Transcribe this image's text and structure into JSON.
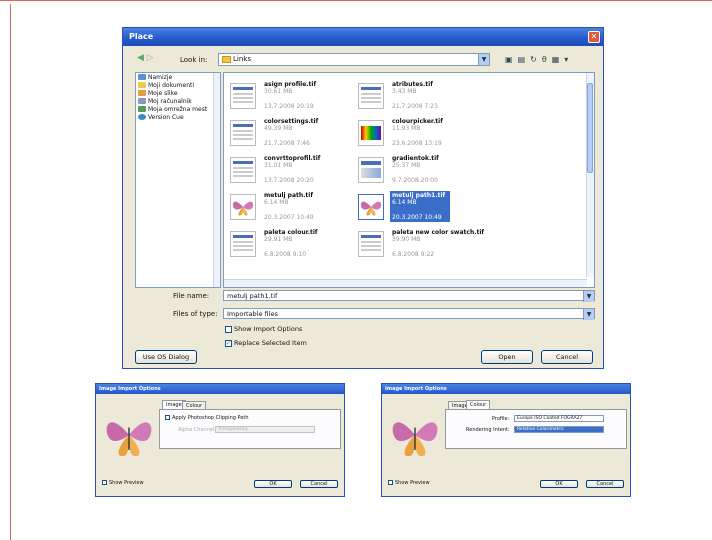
{
  "main_dialog": {
    "title": "Place",
    "look_in_label": "Look in:",
    "look_in_value": "Links",
    "places": [
      "Namizje",
      "Moji dokumenti",
      "Moje slike",
      "Moj računalnik",
      "Moja omrežna mest",
      "Version Cue"
    ],
    "files": [
      {
        "name": "asign profile.tif",
        "size": "30.61 MB",
        "date": "13.7.2008 20:19",
        "thumb": "window"
      },
      {
        "name": "atributes.tif",
        "size": "3.43 MB",
        "date": "21.7.2008 7:23",
        "thumb": "window"
      },
      {
        "name": "colorsettings.tif",
        "size": "49.39 MB",
        "date": "21.7.2008 7:46",
        "thumb": "window"
      },
      {
        "name": "colourpicker.tif",
        "size": "11.93 MB",
        "date": "23.6.2008 13:19",
        "thumb": "gradient"
      },
      {
        "name": "convrttoprofil.tif",
        "size": "31.01 MB",
        "date": "13.7.2008 20:20",
        "thumb": "window"
      },
      {
        "name": "gradientok.tif",
        "size": "25.37 MB",
        "date": "9.7.2008 20:00",
        "thumb": "gradient-window"
      },
      {
        "name": "metulj path.tif",
        "size": "6.14 MB",
        "date": "20.3.2007 10:49",
        "thumb": "butterfly"
      },
      {
        "name": "metulj path1.tif",
        "size": "6.14 MB",
        "date": "20.3.2007 10:49",
        "thumb": "butterfly",
        "selected": true
      },
      {
        "name": "paleta colour.tif",
        "size": "29.91 MB",
        "date": "6.8.2008 9:10",
        "thumb": "window"
      },
      {
        "name": "paleta new color swatch.tif",
        "size": "39.90 MB",
        "date": "6.8.2008 9:22",
        "thumb": "window"
      }
    ],
    "file_name_label": "File name:",
    "file_name_value": "metulj path1.tif",
    "files_of_type_label": "Files of type:",
    "files_of_type_value": "Importable files",
    "show_import_options": "Show Import Options",
    "replace_selected_item": "Replace Selected Item",
    "use_os_dialog": "Use OS Dialog",
    "open": "Open",
    "cancel": "Cancel"
  },
  "image_import_left": {
    "title": "Image Import Options",
    "tab_image": "Image",
    "tab_colour": "Colour",
    "clipping_path": "Apply Photoshop Clipping Path",
    "alpha_channel_label": "Alpha Channel:",
    "alpha_channel_value": "Transparency",
    "show_preview": "Show Preview",
    "ok": "OK",
    "cancel": "Cancel"
  },
  "image_import_right": {
    "title": "Image Import Options",
    "tab_image": "Image",
    "tab_colour": "Colour",
    "profile_label": "Profile:",
    "profile_value": "Europe ISO Coated FOGRA27",
    "rendering_label": "Rendering Intent:",
    "rendering_value": "Relative Colorimetric",
    "show_preview": "Show Preview",
    "ok": "OK",
    "cancel": "Cancel"
  },
  "colors": {
    "title_bar": "#2458cc",
    "dialog_bg": "#ece9d8",
    "selection": "#3b6ec9",
    "frame_line": "#d86a5a"
  }
}
